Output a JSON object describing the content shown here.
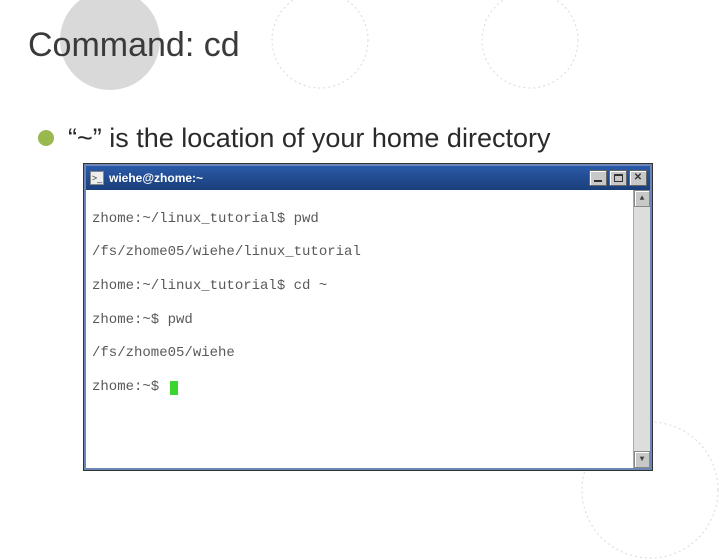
{
  "slide": {
    "title": "Command: cd",
    "bullet_text": "“~” is the location of your home directory"
  },
  "window": {
    "title": "wiehe@zhome:~",
    "icon_label": ">_"
  },
  "terminal": {
    "lines": [
      "zhome:~/linux_tutorial$ pwd",
      "/fs/zhome05/wiehe/linux_tutorial",
      "zhome:~/linux_tutorial$ cd ~",
      "zhome:~$ pwd",
      "/fs/zhome05/wiehe",
      "zhome:~$ "
    ]
  },
  "colors": {
    "accent_green": "#99b84d",
    "caret_green": "#3ad62e",
    "titlebar_blue": "#1a3f7a"
  }
}
